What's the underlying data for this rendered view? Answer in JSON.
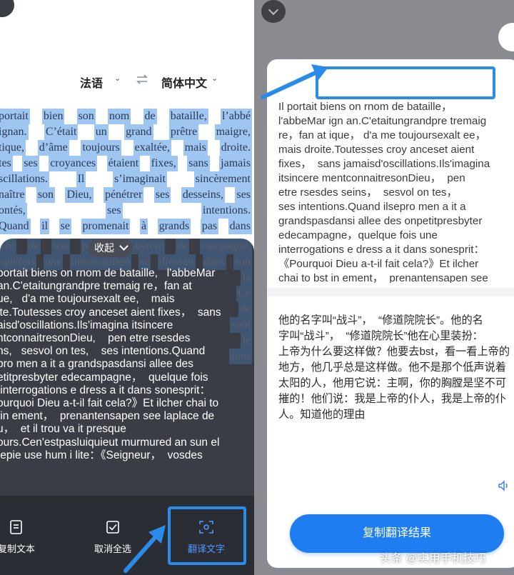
{
  "left": {
    "highlighted_lines": [
      [
        "portait",
        "bien",
        "son",
        "nom",
        "de",
        "bataille,",
        "l’abbé"
      ],
      [
        "ignan.",
        "C’était",
        "un",
        "grand",
        "prêtre",
        "maigre,"
      ],
      [
        "tique,",
        "d’âme",
        "toujours",
        "exaltée,",
        "mais",
        "droite."
      ],
      [
        "tes",
        "ses",
        "croyances",
        "étaient",
        "fixes,",
        "sans",
        "jamais"
      ],
      [
        "scillations.",
        "Il",
        "s’imaginait",
        "sincèrement"
      ],
      [
        "naître",
        "son",
        "Dieu,",
        "pénétrer",
        "ses",
        "desseins,",
        "ses"
      ],
      [
        "ontés,",
        "ses",
        "intentions."
      ],
      [
        "Quand",
        "il",
        "se",
        "promenait",
        "à",
        "grands",
        "pas",
        "dans"
      ]
    ],
    "ghost_lines": [
      [
        "lée",
        "de",
        "son",
        "petit",
        "presbytère",
        "de",
        "campagne,"
      ],
      [
        "quefois",
        "une",
        "interrogation",
        "se",
        "dressait",
        "dans",
        "son"
      ],
      [
        "",
        "",
        "",
        "",
        "",
        "",
        "la"
      ],
      [
        "",
        "",
        "",
        "",
        "",
        "",
        "Ce"
      ],
      [
        "",
        "",
        "",
        "",
        "",
        "",
        "de"
      ],
      [
        "",
        "",
        "",
        "",
        "",
        "",
        "sont"
      ],
      [
        "",
        "",
        "",
        "",
        "",
        "",
        "le"
      ],
      [
        "",
        "",
        "",
        "",
        "",
        "",
        "sons"
      ]
    ],
    "collapse_label": "收起",
    "ocr_text": "portait biens on rnom de bataille,   l'abbeMar\nan.C'etaitungrandpre tremaig re，fan at\nue,   d'a me toujoursexalt ee,    mais\nite.Toutesses croy anceset aient fixes，  sans\naisd'oscillations.Ils'imagina itsincere\nntconnaitresonDieu,    pen etre rsesdes\nns,   sesvol on tes,    ses intentions.Quand\npro men a it a grandspasdansi allee des\netitpresbyter edecampagne，  quelque fois\n interrogations e dress a it dans sonesprit：\nourquoi Dieu a-t-il fait cela?》Et ilcher chai to\n in ement，  prenantensapen see laplace de\nu，  et il trou va it presque\nours.Cen'estpasluiquieut murmured an sun el\n epie use hum i lite：《Seigneur，  vosdes",
    "toolbar": {
      "copy_label": "复制文本",
      "cancel_label": "取消全选",
      "translate_label": "翻译文字"
    }
  },
  "right": {
    "lang_source": "法语",
    "lang_target": "简体中文",
    "original_text": "Il portait biens on rnom de bataille，\nl'abbeMar ign an.C'etaitungrandpre tremaig\nre，fan at ique， d'a me toujoursexalt ee，\nmais droite.Toutesses croy anceset aient\nfixes，  sans jamaisd'oscillations.Ils'imagina\nitsincere mentconnaitresonDieu，  pen\netre rsesdes seins，  sesvol on tes，\nses intentions.Quand ilsepro men a it a\ngrandspasdansi allee des onpetitpresbyter\nedecampagne，quelque fois une\ninterrogations e dress a it dans sonesprit：\n《Pourquoi Dieu a-t-il fait cela?》Et ilcher\nchai to bst in ement，  prenantensapen see",
    "translated_text": "他的名字叫“战斗”，  “修道院院长”。他的名\n字叫“战斗”，  “修道院院长”他在心里装扮：\n上帝为什么要这样做？他要去bst，看一看上帝的\n地方，他几乎总是这样做。他不是那个低声说着\n太阳的人，他用它说：主啊，你的胸膛是坚不可\n摧的！他们说：我是上帝的仆人，我是上帝的仆\n人。知道他的理由",
    "copy_result_label": "复制翻译结果"
  },
  "watermark": "头条 @实用手机技巧",
  "colors": {
    "accent": "#2b8be8",
    "button_blue": "#1e7df0",
    "dark_panel": "#3a3c46"
  }
}
